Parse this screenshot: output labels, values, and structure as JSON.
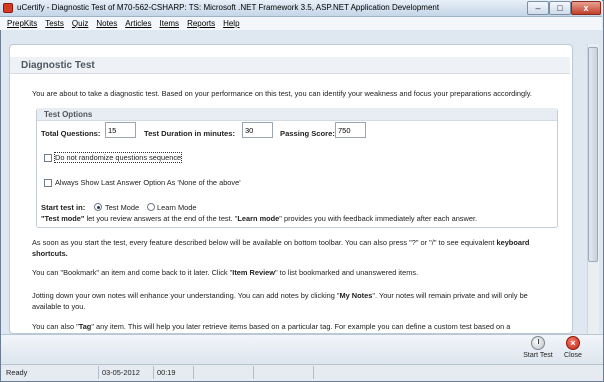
{
  "window": {
    "title": "uCertify - Diagnostic Test of  M70-562-CSHARP: TS: Microsoft .NET Framework 3.5, ASP.NET Application Development",
    "minimize_glyph": "–",
    "maximize_glyph": "□",
    "close_glyph": "x"
  },
  "menu": {
    "items": [
      {
        "label": "PrepKits"
      },
      {
        "label": "Tests"
      },
      {
        "label": "Quiz"
      },
      {
        "label": "Notes"
      },
      {
        "label": "Articles"
      },
      {
        "label": "Items"
      },
      {
        "label": "Reports"
      },
      {
        "label": "Help"
      }
    ]
  },
  "page": {
    "title": "Diagnostic Test",
    "intro": "You are about to take a diagnostic test. Based on your performance on this test, you can identify your weakness and focus your preparations accordingly."
  },
  "options": {
    "section_title": "Test Options",
    "total_questions_label": "Total Questions:",
    "total_questions_value": "15",
    "duration_label": "Test Duration in minutes:",
    "duration_value": "30",
    "passing_score_label": "Passing Score:",
    "passing_score_value": "750",
    "no_randomize_label": "Do not randomize questions sequence",
    "no_randomize_checked": false,
    "last_answer_label": "Always Show Last Answer Option As 'None of the above'",
    "last_answer_checked": false,
    "start_in_label": "Start test in:",
    "test_mode_label": "Test Mode",
    "learn_mode_label": "Learn Mode",
    "selected_mode": "Test Mode",
    "mode_note_test_term": "\"Test mode\"",
    "mode_note_part1": " let you review answers at the end of the test. \"",
    "mode_note_learn_term": "Learn mode",
    "mode_note_part2": "\" provides you with feedback immediately after each answer."
  },
  "body": {
    "p1_a": "As soon as you start the test, every feature described below will be available on bottom toolbar. You can also press \"?\" or \"/\" to see equivalent ",
    "p1_bold": "keyboard",
    "p1_b": "shortcuts.",
    "p2_a": "You can \"Bookmark\" an item and come back to it later. Click \"",
    "p2_bold": "Item Review",
    "p2_b": "\" to list bookmarked and unanswered items.",
    "p3_a": "Jotting down your own notes will enhance your understanding. You can add notes by clicking \"",
    "p3_bold": "My Notes",
    "p3_b": "\". Your notes will remain private and will only be",
    "p3_c": "available to you.",
    "p4_a": "You can also \"",
    "p4_bold": "Tag",
    "p4_b": "\" any item.  This will help you later retrieve items based on a particular tag. For example you can define a custom test based on a"
  },
  "toolbar": {
    "start_test_label": "Start Test",
    "close_label": "Close"
  },
  "status": {
    "state": "Ready",
    "date": "03-05-2012",
    "time": "00:19"
  }
}
